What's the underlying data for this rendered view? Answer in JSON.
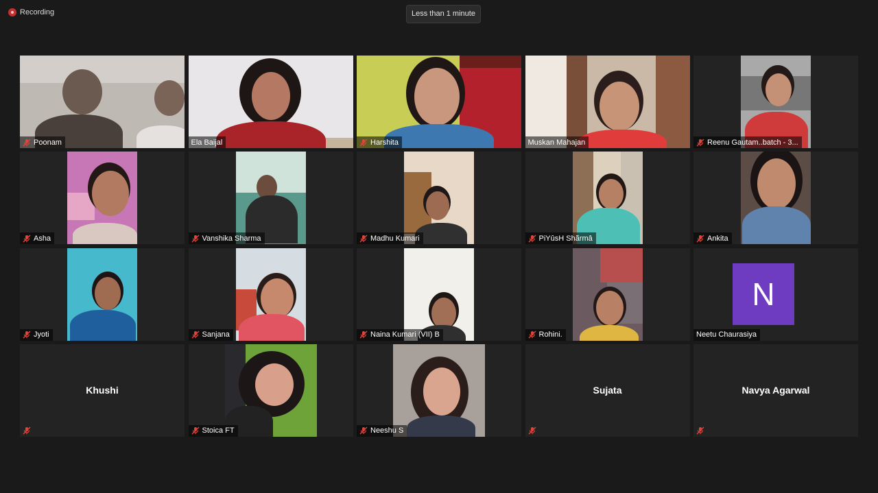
{
  "recording": {
    "label": "Recording"
  },
  "timer": {
    "label": "Less than 1 minute"
  },
  "participants": [
    {
      "name": "Poonam",
      "muted": true
    },
    {
      "name": "Ela Baijal",
      "muted": false,
      "active_speaker": true
    },
    {
      "name": "Harshita",
      "muted": true
    },
    {
      "name": "Muskan Mahajan",
      "muted": false
    },
    {
      "name": "Reenu Gautam..batch - 3...",
      "muted": true
    },
    {
      "name": "Asha",
      "muted": true
    },
    {
      "name": "Vanshika Sharma",
      "muted": true
    },
    {
      "name": "Madhu Kumari",
      "muted": true
    },
    {
      "name": "PiYûsH Shãrmâ",
      "muted": true
    },
    {
      "name": "Ankita",
      "muted": true
    },
    {
      "name": "Jyoti",
      "muted": true
    },
    {
      "name": "Sanjana",
      "muted": true
    },
    {
      "name": "Naina Kumari (VII) B",
      "muted": true
    },
    {
      "name": "Rohini.",
      "muted": true
    },
    {
      "name": "Neetu Chaurasiya",
      "muted": false,
      "avatar_letter": "N"
    },
    {
      "name": "Khushi",
      "muted": true,
      "video_off": true
    },
    {
      "name": "Stoica FT",
      "muted": true
    },
    {
      "name": "Neeshu S",
      "muted": true
    },
    {
      "name": "Sujata",
      "muted": true,
      "video_off": true
    },
    {
      "name": "Navya Agarwal",
      "muted": true,
      "video_off": true
    }
  ],
  "colors": {
    "active_speaker_border": "#e4e46b",
    "mute_icon": "#e0443a",
    "avatar_bg": "#6e3cc0",
    "recording_dot": "#c62f2f"
  }
}
